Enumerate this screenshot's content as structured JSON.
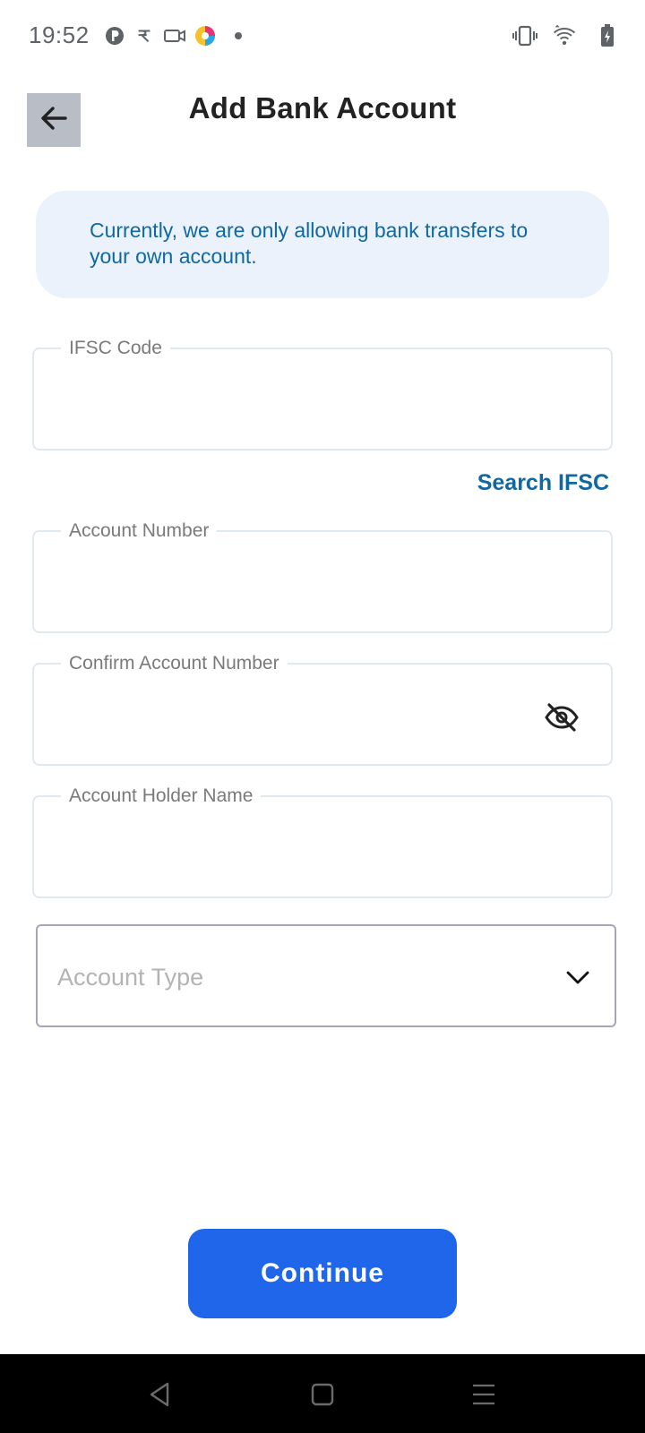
{
  "status_bar": {
    "time": "19:52",
    "left_icons": [
      "p-circle-icon",
      "rupee-app-icon",
      "video-camera-icon",
      "color-app-icon",
      "dot-icon"
    ],
    "right_icons": [
      "vibrate-icon",
      "wifi-icon",
      "battery-charging-icon"
    ]
  },
  "header": {
    "back_icon": "arrow-left-icon",
    "title": "Add Bank Account"
  },
  "info": {
    "text": "Currently, we are only allowing bank transfers to your own account."
  },
  "form": {
    "ifsc": {
      "label": "IFSC Code",
      "value": ""
    },
    "search_ifsc": "Search IFSC",
    "account_number": {
      "label": "Account Number",
      "value": ""
    },
    "confirm_account_number": {
      "label": "Confirm Account Number",
      "value": "",
      "toggle_icon": "eye-off-icon"
    },
    "account_holder_name": {
      "label": "Account Holder Name",
      "value": ""
    },
    "account_type": {
      "placeholder": "Account Type",
      "icon": "chevron-down-icon"
    }
  },
  "actions": {
    "continue_label": "Continue"
  },
  "nav_bar": {
    "icons": [
      "back-triangle-icon",
      "home-square-icon",
      "menu-lines-icon"
    ]
  },
  "colors": {
    "accent_blue": "#1f66ea",
    "link_blue": "#0f68a4",
    "info_bg": "#ebf2fb",
    "field_border": "#dfe9ee",
    "back_button_bg": "#b9bdc6"
  }
}
